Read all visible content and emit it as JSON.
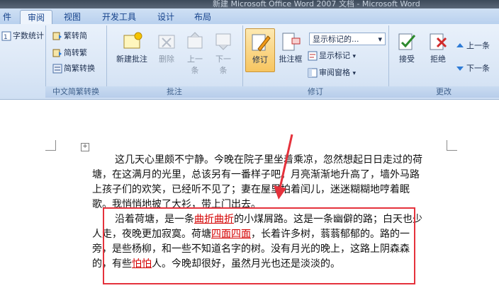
{
  "window": {
    "title": "新建 Microsoft Office Word 2007 文档 - Microsoft Word"
  },
  "tabs": [
    {
      "label": "件"
    },
    {
      "label": "审阅"
    },
    {
      "label": "视图"
    },
    {
      "label": "开发工具"
    },
    {
      "label": "设计"
    },
    {
      "label": "布局"
    }
  ],
  "ribbon": {
    "partial_group": {
      "label": "字数统计"
    },
    "chinese_conversion": {
      "label": "中文简繁转换",
      "to_traditional": "繁转简",
      "to_simplified": "简转繁",
      "conversion": "简繁转换"
    },
    "comments": {
      "label": "批注",
      "new_comment": "新建批注",
      "delete": "删除",
      "previous_line1": "上一",
      "previous_line2": "条",
      "next_line1": "下一",
      "next_line2": "条"
    },
    "tracking": {
      "label": "修订",
      "track_changes": "修订",
      "balloons": "批注框",
      "display_select": "显示标记的...",
      "show_markup": "显示标记",
      "reviewing_pane": "审阅窗格"
    },
    "changes": {
      "label": "更改",
      "accept": "接受",
      "reject": "拒绝",
      "previous": "上一条",
      "next": "下一条"
    }
  },
  "document": {
    "paragraph1": "这几天心里颇不宁静。今晚在院子里坐着乘凉，忽然想起日日走过的荷塘，在这满月的光里，总该另有一番样子吧。月亮渐渐地升高了，墙外马路上孩子们的欢笑，已经听不见了；妻在屋里拍着闰儿，迷迷糊糊地哼着眠歌。我悄悄地披了大衫，带上门出去。",
    "p2_a": "沿着荷塘，是一条",
    "p2_ins1": "曲折曲折",
    "p2_b": "的小煤屑路。这是一条幽僻的路；白天也少人走，夜晚更加寂寞。荷塘",
    "p2_ins2": "四面四面",
    "p2_c": "，长着许多树，蓊蓊郁郁的。路的一旁，是些杨柳，和一些不知道名字的树。没有月光的晚上，这路上阴森森的，有些",
    "p2_ins3": "怕怕",
    "p2_d": "人。今晚却很好，虽然月光也还是淡淡的。"
  },
  "colors": {
    "insertion": "#d40000",
    "annotation": "#e5323c",
    "ribbon_bg": "#dbe7f6",
    "tab_text": "#15428b"
  }
}
